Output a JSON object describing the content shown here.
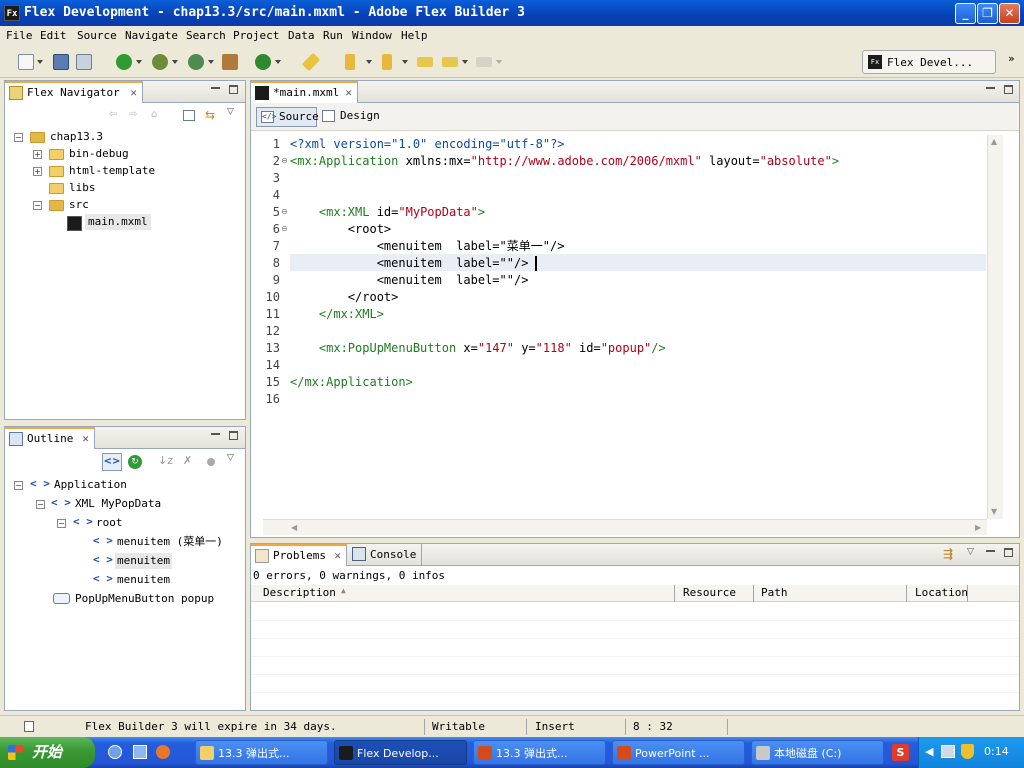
{
  "window": {
    "title": "Flex Development - chap13.3/src/main.mxml - Adobe Flex Builder 3",
    "app_icon": "Fx"
  },
  "menu": [
    "File",
    "Edit",
    "Source",
    "Navigate",
    "Search",
    "Project",
    "Data",
    "Run",
    "Window",
    "Help"
  ],
  "perspective": {
    "label": "Flex Devel...",
    "icon": "Fx"
  },
  "navigator": {
    "tab": "Flex Navigator",
    "tree": [
      {
        "label": "chap13.3"
      },
      {
        "label": "bin-debug"
      },
      {
        "label": "html-template"
      },
      {
        "label": "libs"
      },
      {
        "label": "src"
      },
      {
        "label": "main.mxml"
      }
    ]
  },
  "outline": {
    "tab": "Outline",
    "tree": [
      {
        "label": "Application"
      },
      {
        "label": "XML MyPopData"
      },
      {
        "label": "root"
      },
      {
        "label": "menuitem (菜单一)"
      },
      {
        "label": "menuitem"
      },
      {
        "label": "menuitem"
      },
      {
        "label": "PopUpMenuButton popup"
      }
    ]
  },
  "editor": {
    "tab": "*main.mxml",
    "modes": {
      "source": "Source",
      "design": "Design"
    },
    "line_numbers": [
      "1",
      "2",
      "3",
      "4",
      "5",
      "6",
      "7",
      "8",
      "9",
      "10",
      "11",
      "12",
      "13",
      "14",
      "15",
      "16"
    ],
    "code": {
      "l1": "<?xml version=\"1.0\" encoding=\"utf-8\"?>",
      "l2a": "<mx:Application",
      "l2b": " xmlns:mx=",
      "l2c": "\"http://www.adobe.com/2006/mxml\"",
      "l2d": " layout=",
      "l2e": "\"absolute\"",
      "l2f": ">",
      "l5a": "    <mx:XML",
      "l5b": " id=",
      "l5c": "\"MyPopData\"",
      "l5d": ">",
      "l6": "        <root>",
      "l7a": "            <menuitem  label=",
      "l7b": "\"菜单一\"",
      "l7c": "/>",
      "l8a": "            <menuitem  label=",
      "l8b": "\"\"",
      "l8c": "/>",
      "l9a": "            <menuitem  label=",
      "l9b": "\"\"",
      "l9c": "/>",
      "l10": "        </root>",
      "l11": "    </mx:XML>",
      "l13a": "    <mx:PopUpMenuButton",
      "l13b": " x=",
      "l13c": "\"147\"",
      "l13d": " y=",
      "l13e": "\"118\"",
      "l13f": " id=",
      "l13g": "\"popup\"",
      "l13h": "/>",
      "l15": "</mx:Application>"
    }
  },
  "bottom": {
    "tabs": {
      "problems": "Problems",
      "console": "Console"
    },
    "summary": "0 errors, 0 warnings, 0 infos",
    "columns": [
      "Description",
      "Resource",
      "Path",
      "Location"
    ]
  },
  "status": {
    "message": "Flex Builder 3 will expire in 34 days.",
    "writable": "Writable",
    "insert": "Insert",
    "position": "8 : 32"
  },
  "taskbar": {
    "start": "开始",
    "tasks": [
      "13.3 弹出式...",
      "Flex Develop...",
      "13.3 弹出式...",
      "PowerPoint ...",
      "本地磁盘 (C:)"
    ],
    "clock": "0:14"
  }
}
